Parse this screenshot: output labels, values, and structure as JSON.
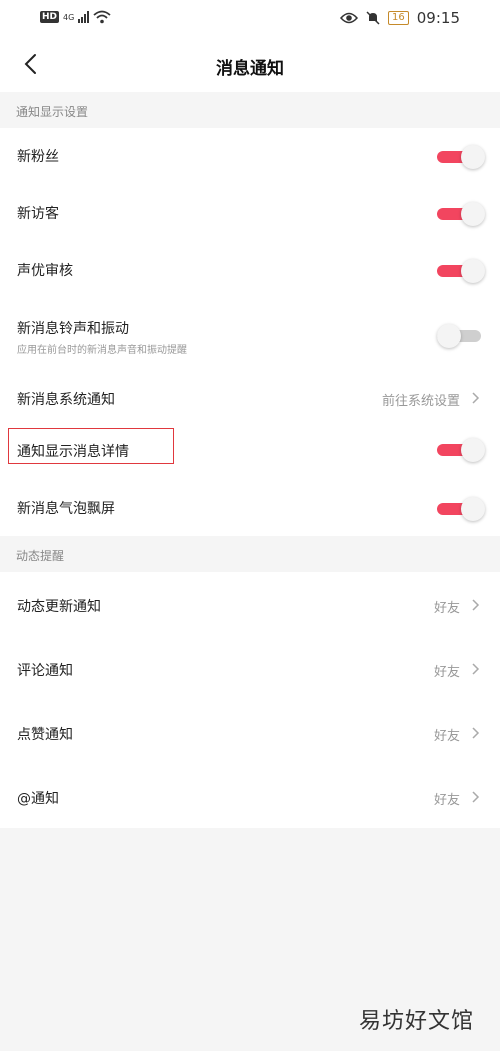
{
  "status_bar": {
    "hd": "HD",
    "network": "4G",
    "battery": "16",
    "time": "09:15"
  },
  "header": {
    "title": "消息通知"
  },
  "sections": {
    "display": {
      "title": "通知显示设置",
      "rows": [
        {
          "label": "新粉丝",
          "toggle": "on"
        },
        {
          "label": "新访客",
          "toggle": "on"
        },
        {
          "label": "声优审核",
          "toggle": "on"
        },
        {
          "label": "新消息铃声和振动",
          "sublabel": "应用在前台时的新消息声音和振动提醒",
          "toggle": "off"
        },
        {
          "label": "新消息系统通知",
          "value": "前往系统设置"
        },
        {
          "label": "通知显示消息详情",
          "toggle": "on"
        },
        {
          "label": "新消息气泡飘屏",
          "toggle": "on"
        }
      ]
    },
    "dynamic": {
      "title": "动态提醒",
      "rows": [
        {
          "label": "动态更新通知",
          "value": "好友"
        },
        {
          "label": "评论通知",
          "value": "好友"
        },
        {
          "label": "点赞通知",
          "value": "好友"
        },
        {
          "label": "@通知",
          "value": "好友"
        }
      ]
    }
  },
  "watermark": "易坊好文馆",
  "colors": {
    "toggle_on": "#f2455f",
    "toggle_off": "#cfcfcf",
    "highlight_border": "#e0383e",
    "background": "#f5f5f5"
  }
}
